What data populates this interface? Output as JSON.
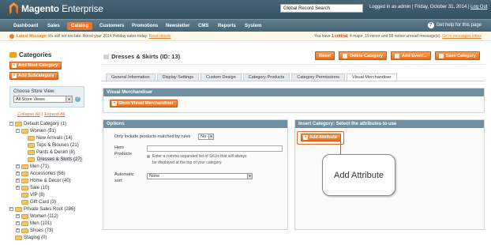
{
  "header": {
    "logo_brand": "Magento",
    "logo_suffix": "Enterprise",
    "search_value": "Global Record Search",
    "user_text": "Logged in as admin  |  Friday, October 31, 2014  |",
    "logout": "Log Out"
  },
  "nav": {
    "items": [
      "Dashboard",
      "Sales",
      "Catalog",
      "Customers",
      "Promotions",
      "Newsletter",
      "CMS",
      "Reports",
      "System"
    ],
    "help": "Get help for this page"
  },
  "notice": {
    "left_label": "Latest Message:",
    "left_text": "It's still not too late. Boost your 2014 Holiday sales today.",
    "left_link": "Read details",
    "right_pre": "You have",
    "right_critical": "1 critical",
    "right_rest": ", 4 major, 19 minor and 58 notice unread message(s).",
    "right_link": "Go to messages inbox"
  },
  "sidebar": {
    "title": "Categories",
    "add_root": "Add Root Category",
    "add_sub": "Add Subcategory",
    "store_label": "Choose Store View:",
    "store_value": "All Store Views",
    "collapse": "Collapse All",
    "expand": "Expand All",
    "tree": [
      {
        "label": "Default Category (1)",
        "level": 0,
        "toggle": "−"
      },
      {
        "label": "Women (51)",
        "level": 1,
        "toggle": "−"
      },
      {
        "label": "New Arrivals (14)",
        "level": 2,
        "toggle": ""
      },
      {
        "label": "Tops & Blouses (21)",
        "level": 2,
        "toggle": ""
      },
      {
        "label": "Pants & Denim (8)",
        "level": 2,
        "toggle": ""
      },
      {
        "label": "Dresses & Skirts (27)",
        "level": 2,
        "toggle": "",
        "selected": true
      },
      {
        "label": "Men (71)",
        "level": 1,
        "toggle": "+"
      },
      {
        "label": "Accessories (56)",
        "level": 1,
        "toggle": "+"
      },
      {
        "label": "Home & Decor (40)",
        "level": 1,
        "toggle": "+"
      },
      {
        "label": "Sale (10)",
        "level": 1,
        "toggle": "+"
      },
      {
        "label": "VIP (8)",
        "level": 1,
        "toggle": ""
      },
      {
        "label": "Gift Card (3)",
        "level": 1,
        "toggle": ""
      },
      {
        "label": "Private Sales Root (286)",
        "level": 0,
        "toggle": "−"
      },
      {
        "label": "Women (112)",
        "level": 1,
        "toggle": "+"
      },
      {
        "label": "Men (101)",
        "level": 1,
        "toggle": "+"
      },
      {
        "label": "Shoes (73)",
        "level": 1,
        "toggle": "+"
      },
      {
        "label": "Staging (0)",
        "level": 0,
        "toggle": ""
      }
    ]
  },
  "main": {
    "title": "Dresses & Skirts (ID: 13)",
    "buttons": {
      "reset": "Reset",
      "delete": "Delete Category",
      "add_event": "Add Event...",
      "save": "Save Category"
    },
    "tabs": [
      "General Information",
      "Display Settings",
      "Custom Design",
      "Category Products",
      "Category Permissions",
      "Visual Merchandiser"
    ],
    "active_tab": 5,
    "vm_head": "Visual Merchandiser",
    "vm_button": "Show Visual Merchandiser",
    "options": {
      "head": "Options",
      "rules_label": "Only include products matched by rules",
      "rules_value": "No",
      "hero_label_1": "Hero",
      "hero_label_2": "Products",
      "hero_note": "Enter a comma separated list of SKUs that will always be displayed at the top of your category.",
      "auto_label_1": "Automatic",
      "auto_label_2": "sort",
      "auto_value": "None"
    },
    "insert": {
      "head": "Insert Category: Select the attributes to use",
      "button": "Add Attribute"
    },
    "callout": "Add Attribute"
  },
  "colors": {
    "accent": "#e8742d",
    "header": "#3d5868",
    "panel_head": "#6f8fa0"
  }
}
